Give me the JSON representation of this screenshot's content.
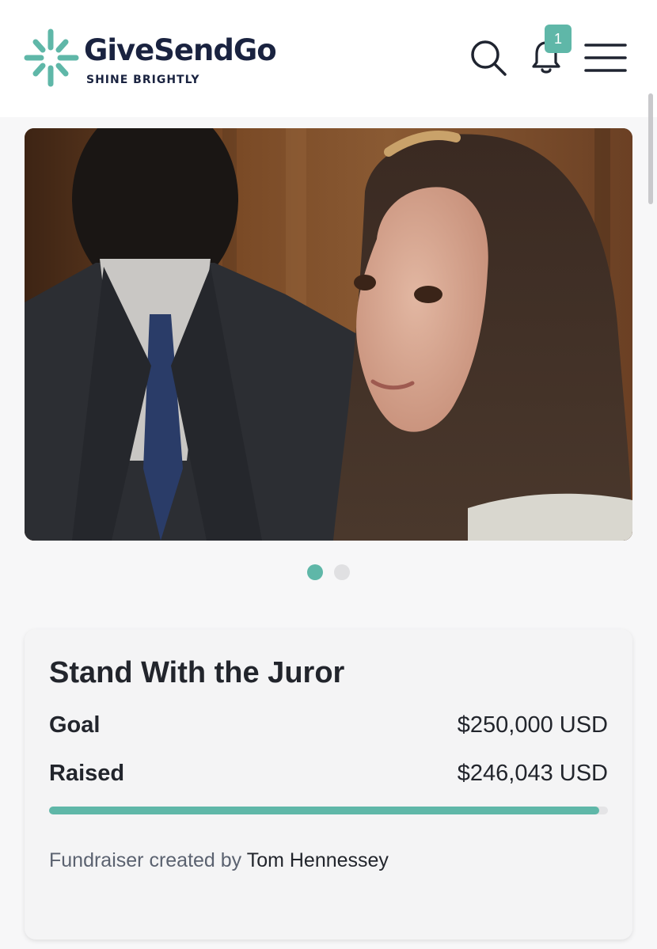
{
  "header": {
    "brand_name": "GiveSendGo",
    "tagline": "SHINE BRIGHTLY",
    "notification_count": "1",
    "accent_color": "#5fb7a8",
    "brand_text_color": "#1a2340",
    "icons": [
      "search-icon",
      "bell-icon",
      "hamburger-menu-icon"
    ]
  },
  "carousel": {
    "slide_count": 2,
    "active_index": 0
  },
  "campaign": {
    "title": "Stand With the Juror",
    "goal_label": "Goal",
    "goal_value": "$250,000 USD",
    "raised_label": "Raised",
    "raised_value": "$246,043 USD",
    "progress_fraction": 0.984,
    "creator_prefix": "Fundraiser created by",
    "creator_name": "Tom Hennessey"
  }
}
